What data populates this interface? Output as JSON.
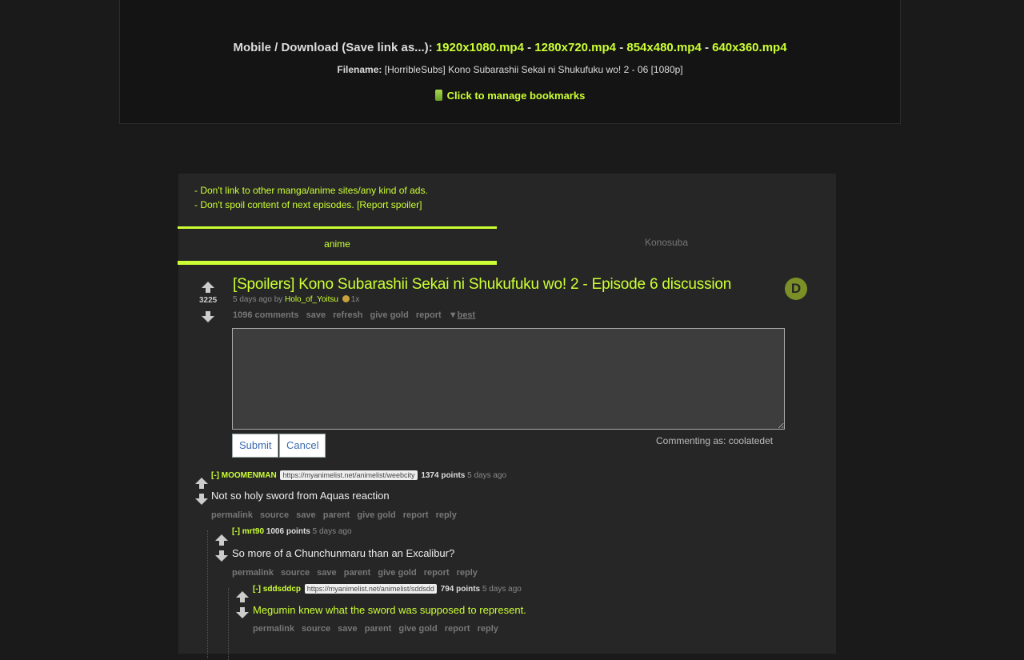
{
  "download": {
    "label": "Mobile / Download (Save link as...):",
    "links": [
      "1920x1080.mp4",
      "1280x720.mp4",
      "854x480.mp4",
      "640x360.mp4"
    ],
    "separator": " - ",
    "filename_label": "Filename:",
    "filename": "[HorribleSubs] Kono Subarashii Sekai ni Shukufuku wo! 2 - 06 [1080p]",
    "bookmark_label": "Click to manage bookmarks"
  },
  "rules": {
    "line1": "- Don't link to other manga/anime sites/any kind of ads.",
    "line2": "- Don't spoil content of next episodes.",
    "report": "[Report spoiler]"
  },
  "tabs": [
    {
      "label": "anime",
      "active": true
    },
    {
      "label": "Konosuba",
      "active": false
    }
  ],
  "post": {
    "score": "3225",
    "title": "[Spoilers] Kono Subarashii Sekai ni Shukufuku wo! 2 - Episode 6 discussion",
    "meta_time": "5 days ago by",
    "author": "Holo_of_Yoitsu",
    "gold_count": "1x",
    "actions": [
      "1096 comments",
      "save",
      "refresh",
      "give gold",
      "report"
    ],
    "sort_prefix": "▼",
    "sort": "best"
  },
  "reply": {
    "submit": "Submit",
    "cancel": "Cancel",
    "commenting_as": "Commenting as: coolatedet"
  },
  "comments": [
    {
      "toggle": "[-]",
      "user": "MOOMENMAN",
      "flair": "https://myanimelist.net/animelist/weebcity",
      "points": "1374 points",
      "time": "5 days ago",
      "body": "Not so holy sword from Aquas reaction",
      "actions": [
        "permalink",
        "source",
        "save",
        "parent",
        "give gold",
        "report",
        "reply"
      ]
    },
    {
      "toggle": "[-]",
      "user": "mrt90",
      "flair": "",
      "points": "1006 points",
      "time": "5 days ago",
      "body": "So more of a Chunchunmaru than an Excalibur?",
      "actions": [
        "permalink",
        "source",
        "save",
        "parent",
        "give gold",
        "report",
        "reply"
      ]
    },
    {
      "toggle": "[-]",
      "user": "sddsddcp",
      "flair": "https://myanimelist.net/animelist/sddsdd",
      "points": "794 points",
      "time": "5 days ago",
      "body": "Megumin knew what the sword was supposed to represent.",
      "actions": [
        "permalink",
        "source",
        "save",
        "parent",
        "give gold",
        "report",
        "reply"
      ]
    }
  ]
}
